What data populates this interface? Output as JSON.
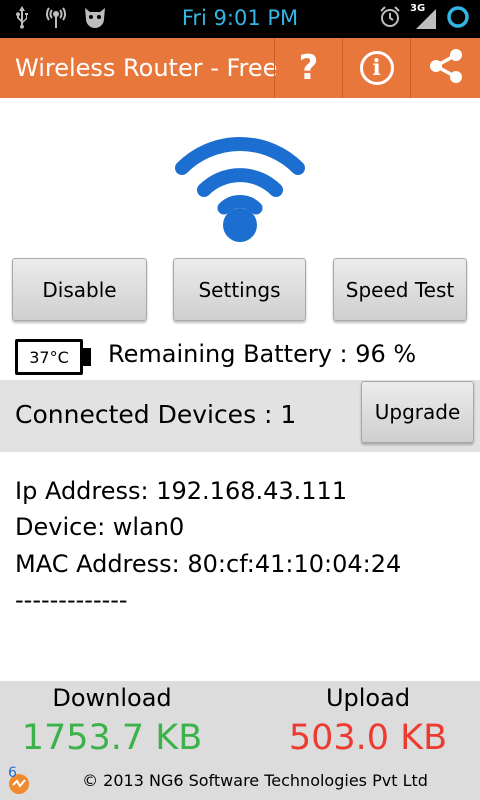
{
  "status_bar": {
    "time": "Fri 9:01 PM",
    "network_label": "3G",
    "left_icons": [
      "usb-icon",
      "wireless-hotspot-icon",
      "android-debug-icon"
    ],
    "right_icons": [
      "alarm-icon",
      "signal-3g-icon",
      "battery-ring-icon"
    ],
    "accent_color": "#33b5e5"
  },
  "action_bar": {
    "title": "Wireless Router - Free",
    "help_label": "?",
    "info_label": "i",
    "share_icon": "share-icon",
    "color": "#e8773c"
  },
  "hotspot": {
    "icon": "wifi-icon",
    "color": "#1c6fd1"
  },
  "buttons": {
    "disable": "Disable",
    "settings": "Settings",
    "speed_test": "Speed Test"
  },
  "battery": {
    "temperature": "37°C",
    "text": "Remaining Battery : 96 %"
  },
  "devices": {
    "text": "Connected Devices : 1",
    "upgrade": "Upgrade",
    "entries": [
      {
        "ip": "Ip Address: 192.168.43.111",
        "device": "Device: wlan0",
        "mac": "MAC Address: 80:cf:41:10:04:24",
        "separator": "-------------"
      }
    ]
  },
  "traffic": {
    "download_label": "Download",
    "download_value": "1753.7 KB",
    "download_color": "#3bb34a",
    "upload_label": "Upload",
    "upload_value": "503.0 KB",
    "upload_color": "#ee3b32"
  },
  "footer": {
    "copyright": "© 2013 NG6 Software Technologies Pvt Ltd",
    "logo_icon": "ng6-logo-icon",
    "logo_text": "6"
  }
}
